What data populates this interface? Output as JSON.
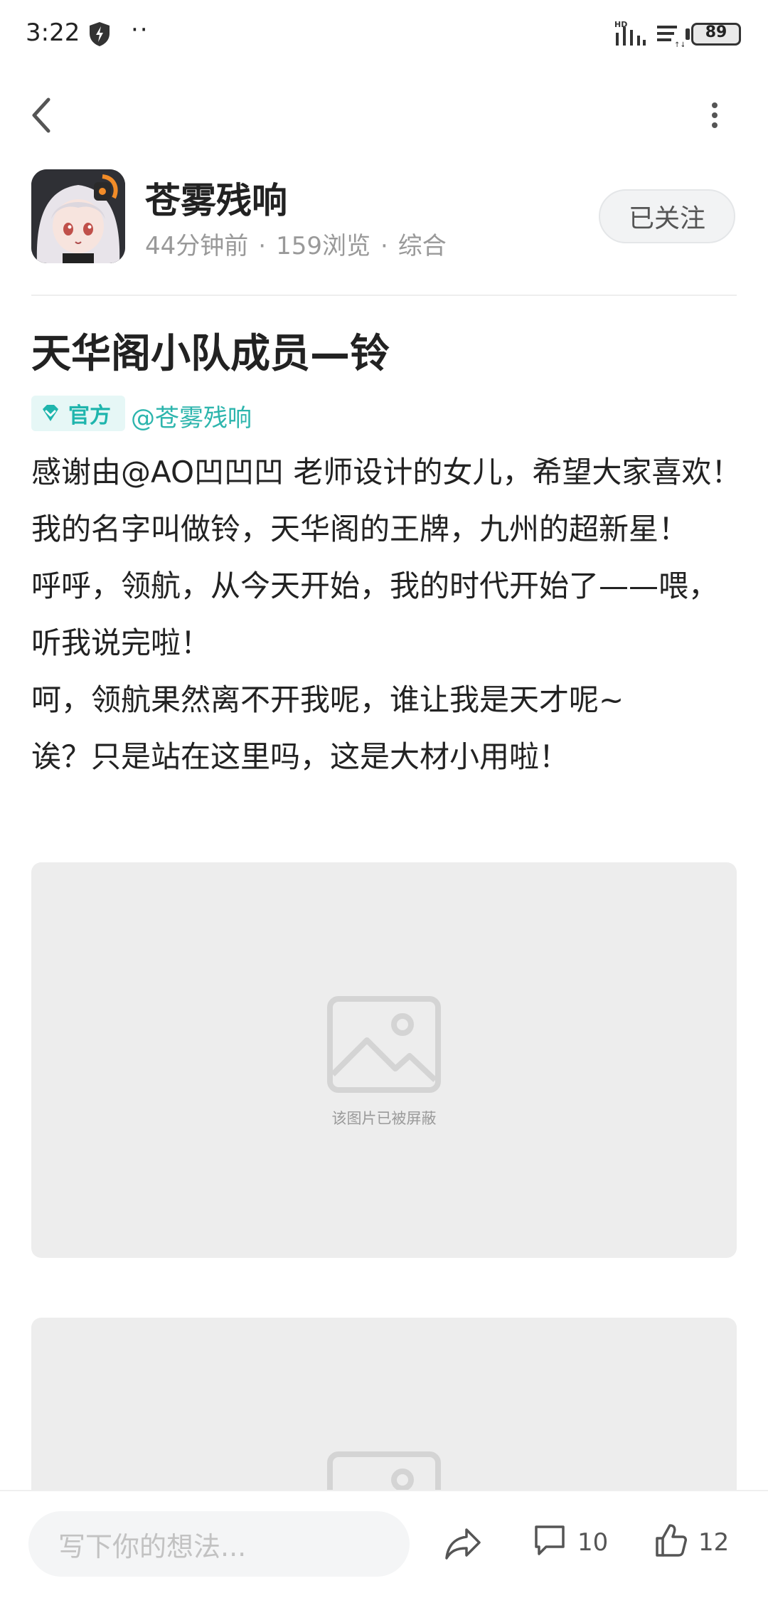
{
  "status_bar": {
    "time": "3:22",
    "extra": "··",
    "battery": "89"
  },
  "author": {
    "name": "苍雾残响",
    "time_ago": "44分钟前",
    "views": "159浏览",
    "category": "综合",
    "separator": "·",
    "follow_label": "已关注"
  },
  "post": {
    "title": "天华阁小队成员—铃",
    "badge_label": "官方",
    "mention": "@苍雾残响",
    "paragraphs": [
      "感谢由@AO凹凹凹 老师设计的女儿，希望大家喜欢！",
      "我的名字叫做铃，天华阁的王牌，九州的超新星！",
      "呼呼，领航，从今天开始，我的时代开始了——喂，听我说完啦！",
      "呵，领航果然离不开我呢，谁让我是天才呢~",
      "诶？只是站在这里吗，这是大材小用啦！"
    ],
    "image_blocked_text": "该图片已被屏蔽"
  },
  "bottom_bar": {
    "comment_placeholder": "写下你的想法...",
    "comment_count": "10",
    "like_count": "12"
  },
  "colors": {
    "accent": "#1fb5ad",
    "meta": "#999999",
    "placeholder_bg": "#ededed"
  },
  "icons": [
    "back-icon",
    "more-icon",
    "shield-icon",
    "official-check-icon",
    "image-placeholder-icon",
    "share-icon",
    "comment-icon",
    "like-icon"
  ]
}
